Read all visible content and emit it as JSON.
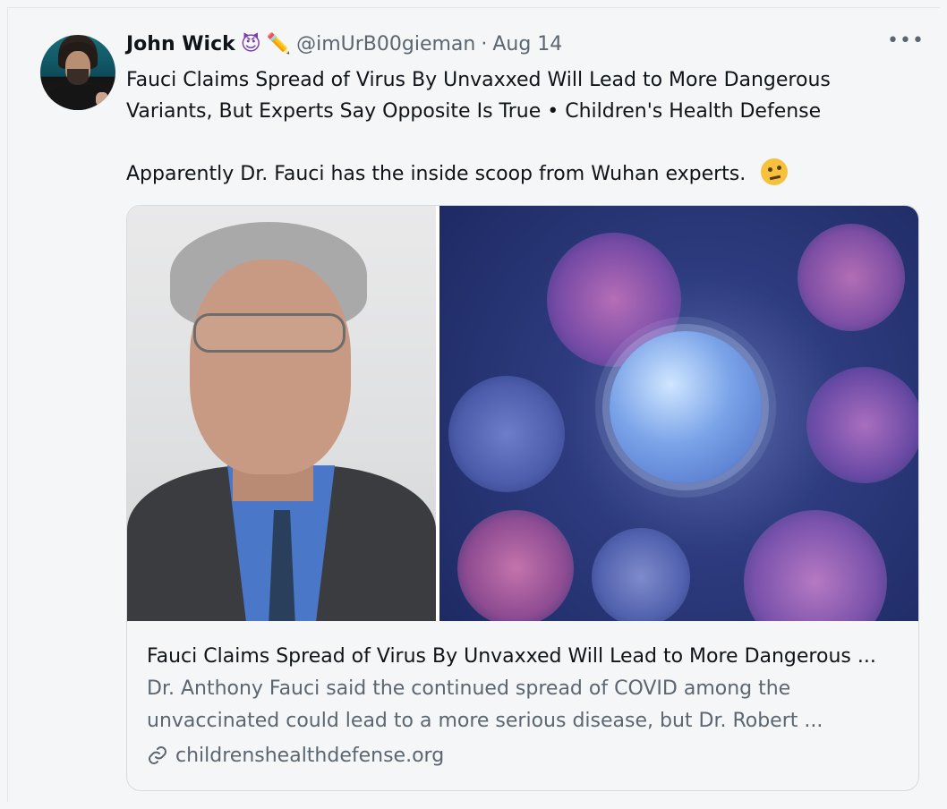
{
  "tweet": {
    "author_name": "John Wick",
    "author_emojis": [
      "😈",
      "✏️"
    ],
    "handle": "@imUrB00gieman",
    "separator": "·",
    "date": "Aug 14",
    "more_label": "•••",
    "text_lines": [
      "Fauci Claims Spread of Virus By Unvaxxed Will Lead to More Dangerous",
      "Variants, But Experts Say Opposite Is True • Children's Health Defense",
      "Apparently Dr. Fauci has the inside scoop from Wuhan experts."
    ],
    "text_emoji": "face-with-raised-eyebrow-icon"
  },
  "card": {
    "title": "Fauci Claims Spread of Virus By Unvaxxed Will Lead to More Dangerous ...",
    "description_lines": [
      "Dr. Anthony Fauci said the continued spread of COVID among the",
      "unvaccinated could lead to a more serious disease, but Dr. Robert ..."
    ],
    "domain": "childrenshealthdefense.org",
    "link_icon": "link-icon"
  },
  "colors": {
    "background": "#f5f6f7",
    "text_primary": "#0f1419",
    "text_secondary": "#5b6670",
    "card_border": "#d6dbe0"
  }
}
